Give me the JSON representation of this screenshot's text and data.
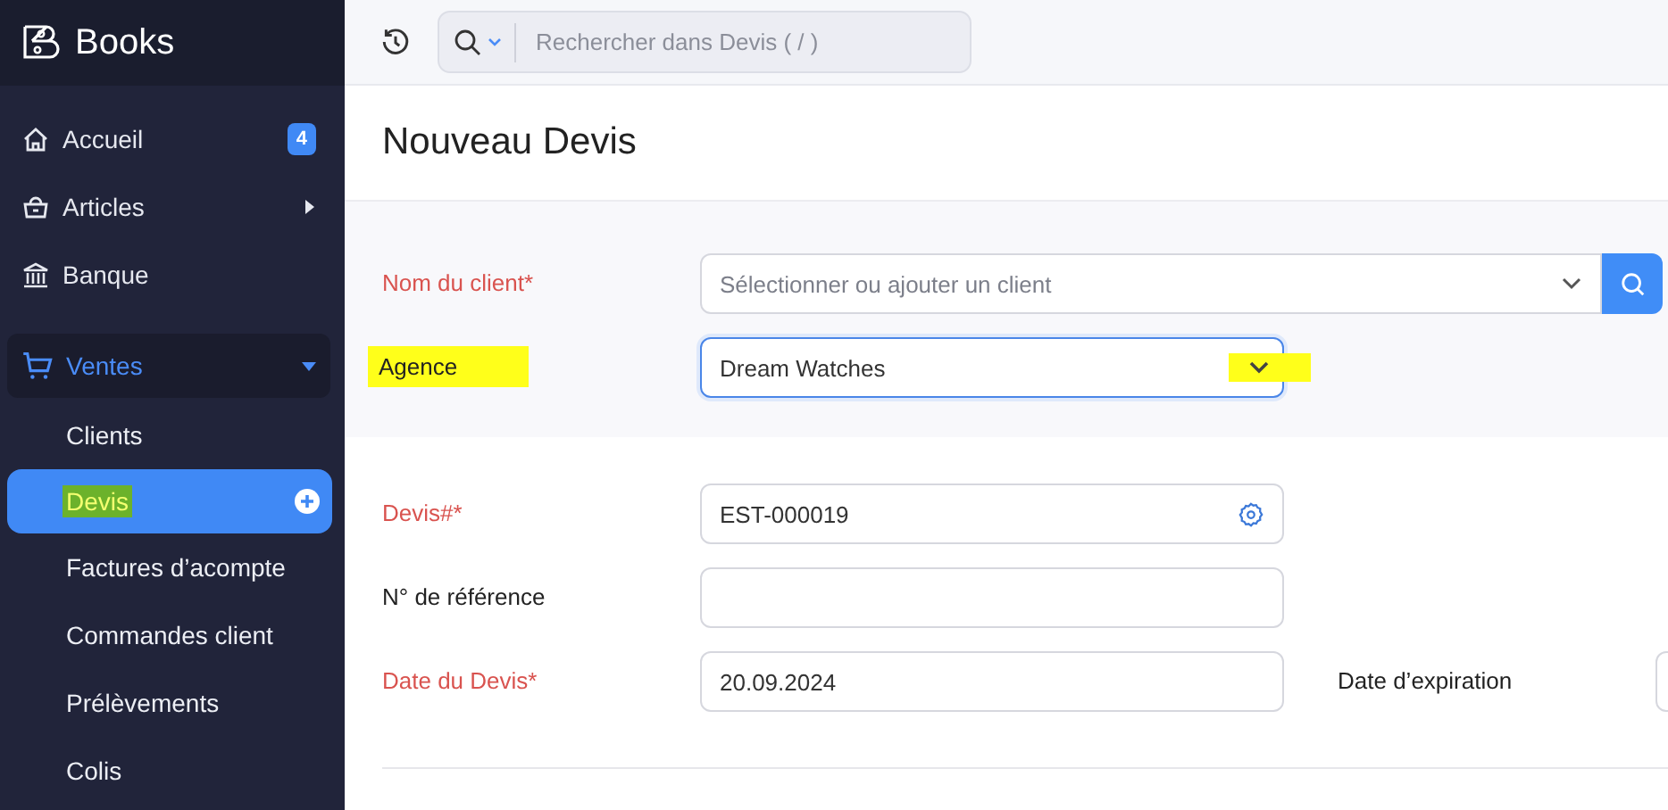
{
  "sidebar": {
    "brand": "Books",
    "items": [
      {
        "label": "Accueil",
        "badge": "4",
        "selected": false
      },
      {
        "label": "Articles",
        "expanded": false,
        "selected": false
      },
      {
        "label": "Banque",
        "selected": false
      },
      {
        "label": "Ventes",
        "expanded": true,
        "selected": true,
        "children": [
          {
            "label": "Clients",
            "selected": false,
            "highlighted": false
          },
          {
            "label": "Devis",
            "selected": true,
            "highlighted": true
          },
          {
            "label": "Factures d’acompte",
            "selected": false,
            "highlighted": false
          },
          {
            "label": "Commandes client",
            "selected": false,
            "highlighted": false
          },
          {
            "label": "Prélèvements",
            "selected": false,
            "highlighted": false
          },
          {
            "label": "Colis",
            "selected": false,
            "highlighted": false
          }
        ]
      }
    ]
  },
  "topbar": {
    "search": {
      "placeholder": "Rechercher dans Devis ( / )"
    }
  },
  "title": "Nouveau Devis",
  "sections": [
    {
      "shaded": true,
      "fields": [
        {
          "kind": "client",
          "label": "Nom du client*",
          "required": true,
          "highlighted": false,
          "placeholder": "Sélectionner ou ajouter un client",
          "focused": false
        },
        {
          "kind": "select",
          "label": "Agence",
          "required": false,
          "highlighted": true,
          "value": "Dream Watches",
          "focused": true,
          "caret_highlighted": true
        }
      ]
    },
    {
      "shaded": false,
      "fields": [
        {
          "kind": "number",
          "label": "Devis#*",
          "required": true,
          "highlighted": false,
          "value": "EST-000019",
          "focused": false
        },
        {
          "kind": "text",
          "label": "N° de référence",
          "required": false,
          "highlighted": false,
          "focused": false
        },
        {
          "kind": "date",
          "label": "Date du Devis*",
          "required": true,
          "highlighted": false,
          "value": "20.09.2024",
          "focused": false,
          "second_label": "Date d’expiration"
        }
      ]
    }
  ]
}
